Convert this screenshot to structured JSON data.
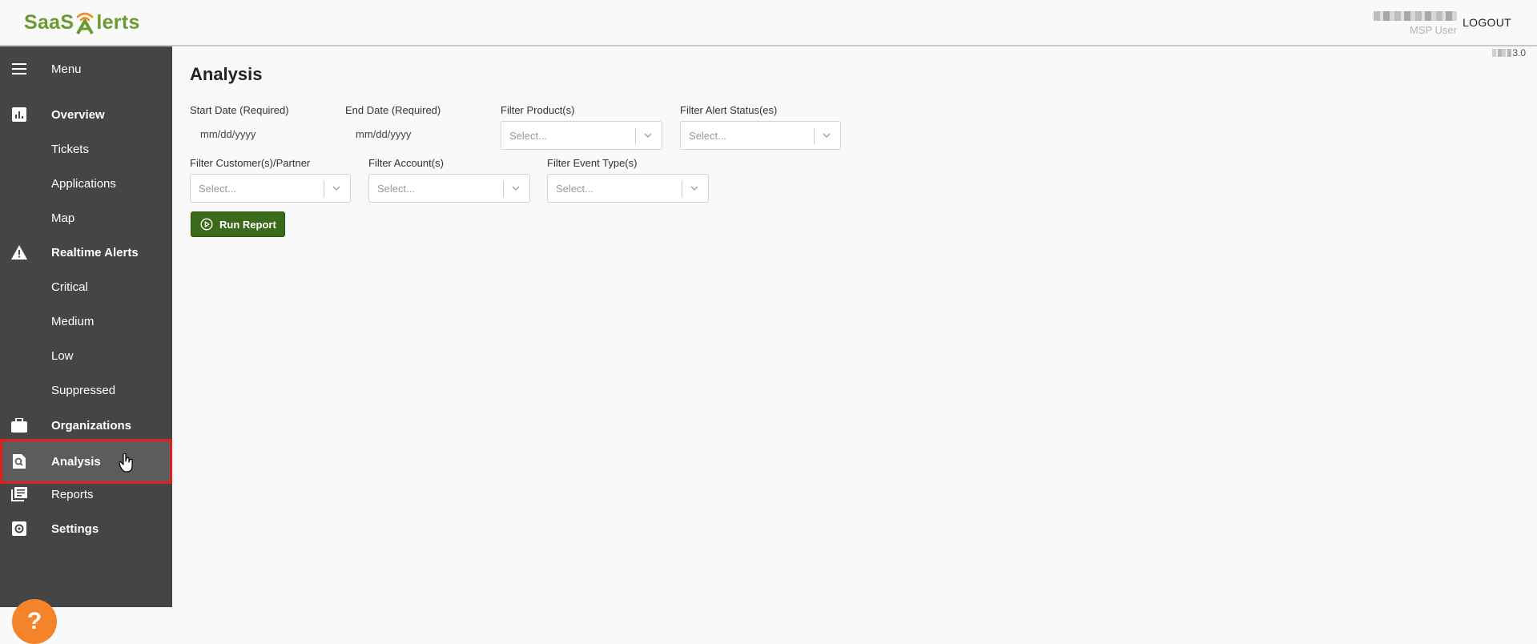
{
  "header": {
    "logo_text_left": "SaaS",
    "logo_text_right": "lerts",
    "user_role": "MSP User",
    "logout_label": "LOGOUT",
    "version_suffix": "3.0"
  },
  "sidebar": {
    "menu_label": "Menu",
    "items": [
      {
        "label": "Overview",
        "icon": "bar-chart-icon",
        "bold": true
      },
      {
        "label": "Tickets",
        "icon": "",
        "bold": false
      },
      {
        "label": "Applications",
        "icon": "",
        "bold": false
      },
      {
        "label": "Map",
        "icon": "",
        "bold": false
      },
      {
        "label": "Realtime Alerts",
        "icon": "warning-icon",
        "bold": true
      },
      {
        "label": "Critical",
        "icon": "",
        "bold": false
      },
      {
        "label": "Medium",
        "icon": "",
        "bold": false
      },
      {
        "label": "Low",
        "icon": "",
        "bold": false
      },
      {
        "label": "Suppressed",
        "icon": "",
        "bold": false
      },
      {
        "label": "Organizations",
        "icon": "briefcase-icon",
        "bold": true
      },
      {
        "label": "Analysis",
        "icon": "document-search-icon",
        "bold": true,
        "active": true
      },
      {
        "label": "Reports",
        "icon": "reports-icon",
        "bold": false
      },
      {
        "label": "Settings",
        "icon": "gear-icon",
        "bold": true
      }
    ],
    "help_label": "?"
  },
  "main": {
    "title": "Analysis",
    "start_date": {
      "label": "Start Date (Required)",
      "placeholder": "mm/dd/yyyy"
    },
    "end_date": {
      "label": "End Date (Required)",
      "placeholder": "mm/dd/yyyy"
    },
    "filter_products": {
      "label": "Filter Product(s)",
      "placeholder": "Select..."
    },
    "filter_alert_status": {
      "label": "Filter Alert Status(es)",
      "placeholder": "Select..."
    },
    "filter_customers": {
      "label": "Filter Customer(s)/Partner",
      "placeholder": "Select..."
    },
    "filter_accounts": {
      "label": "Filter Account(s)",
      "placeholder": "Select..."
    },
    "filter_event_types": {
      "label": "Filter Event Type(s)",
      "placeholder": "Select..."
    },
    "run_report_label": "Run Report"
  },
  "colors": {
    "sidebar_bg": "#454545",
    "accent_green": "#3b6b1a",
    "logo_green": "#6a9a30",
    "logo_orange": "#f08a24",
    "help_orange": "#f5832a",
    "active_outline": "#e0201c"
  }
}
